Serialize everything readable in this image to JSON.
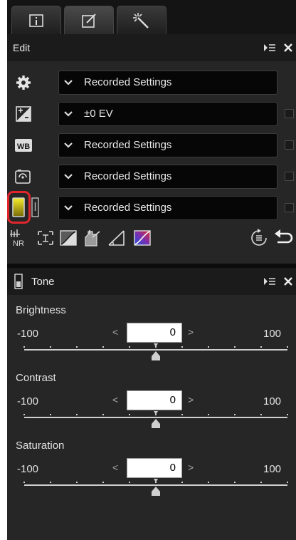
{
  "edit": {
    "title": "Edit",
    "rows": [
      {
        "icon": "gear-icon",
        "value": "Recorded Settings",
        "checkbox": false
      },
      {
        "icon": "exposure-compensation-icon",
        "value": "±0 EV",
        "checkbox": true
      },
      {
        "icon": "white-balance-icon",
        "value": "Recorded Settings",
        "checkbox": true
      },
      {
        "icon": "picture-control-icon",
        "value": "Recorded Settings",
        "checkbox": true
      },
      {
        "icon": "active-d-lighting-icon",
        "value": "Recorded Settings",
        "checkbox": true
      }
    ],
    "wb_badge": "WB",
    "nr_badge": "NR"
  },
  "tone": {
    "title": "Tone",
    "params": [
      {
        "label": "Brightness",
        "value": "0",
        "min": "-100",
        "max": "100",
        "level": 0
      },
      {
        "label": "Contrast",
        "value": "0",
        "min": "-100",
        "max": "100",
        "level": 0
      },
      {
        "label": "Saturation",
        "value": "0",
        "min": "-100",
        "max": "100",
        "level": 0
      }
    ]
  },
  "colors": {
    "highlight": "#e0262b",
    "panel": "#262626",
    "header": "#1b1b1b"
  }
}
